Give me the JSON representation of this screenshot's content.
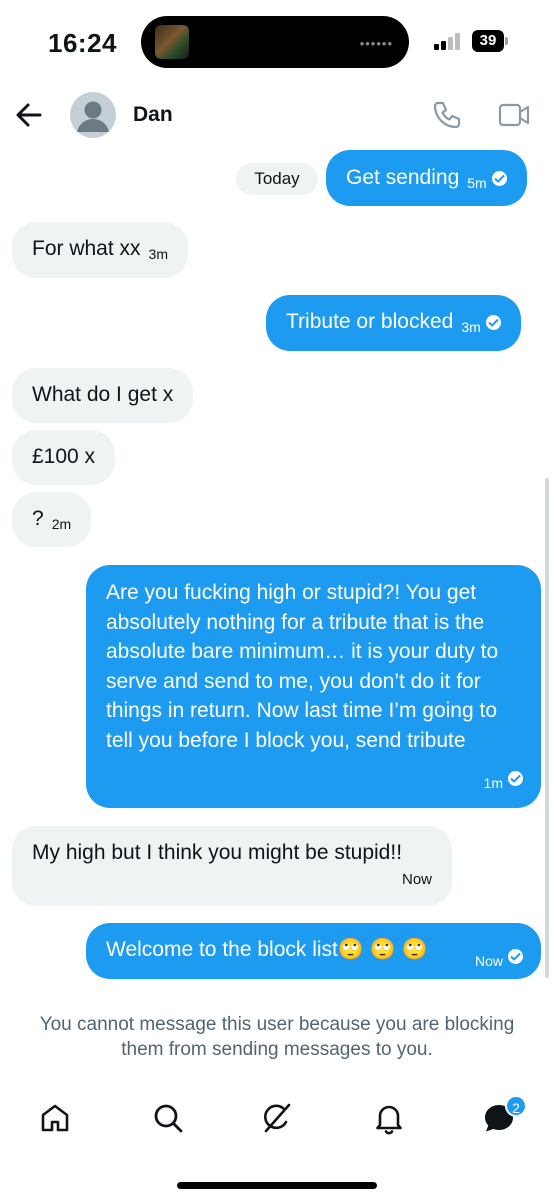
{
  "status": {
    "time": "16:24",
    "battery": "39"
  },
  "header": {
    "contact_name": "Dan"
  },
  "divider": {
    "today": "Today"
  },
  "messages": [
    {
      "dir": "out",
      "text": "Get sending",
      "time": "5m"
    },
    {
      "dir": "in",
      "text": "For what xx",
      "time": "3m"
    },
    {
      "dir": "out",
      "text": "Tribute or blocked",
      "time": "3m"
    },
    {
      "dir": "in",
      "text": "What do I get x",
      "time": ""
    },
    {
      "dir": "in",
      "text": "£100 x",
      "time": ""
    },
    {
      "dir": "in",
      "text": "?",
      "time": "2m"
    },
    {
      "dir": "out",
      "text": "Are you fucking high or stupid?! You get absolutely nothing for a tribute that is the absolute bare minimum… it is your duty to serve and send to me, you don’t do it for things in return. Now last time I’m going to tell you before I block you, send tribute",
      "time": "1m"
    },
    {
      "dir": "in",
      "text": "My high but I think you might be stupid!!",
      "time": "Now"
    },
    {
      "dir": "out",
      "text": "Welcome to the block list🙄 🙄 🙄",
      "time": "Now"
    }
  ],
  "footer": {
    "note": "You cannot message this user because you are blocking them from sending messages to you."
  },
  "nav": {
    "messages_badge": "2"
  },
  "colors": {
    "accent": "#1d9bf0",
    "incoming_bubble": "#eff3f4",
    "muted_text": "#536471"
  },
  "icons": [
    "back-arrow-icon",
    "phone-icon",
    "video-camera-icon",
    "home-icon",
    "search-icon",
    "grok-icon",
    "bell-icon",
    "messages-icon"
  ]
}
